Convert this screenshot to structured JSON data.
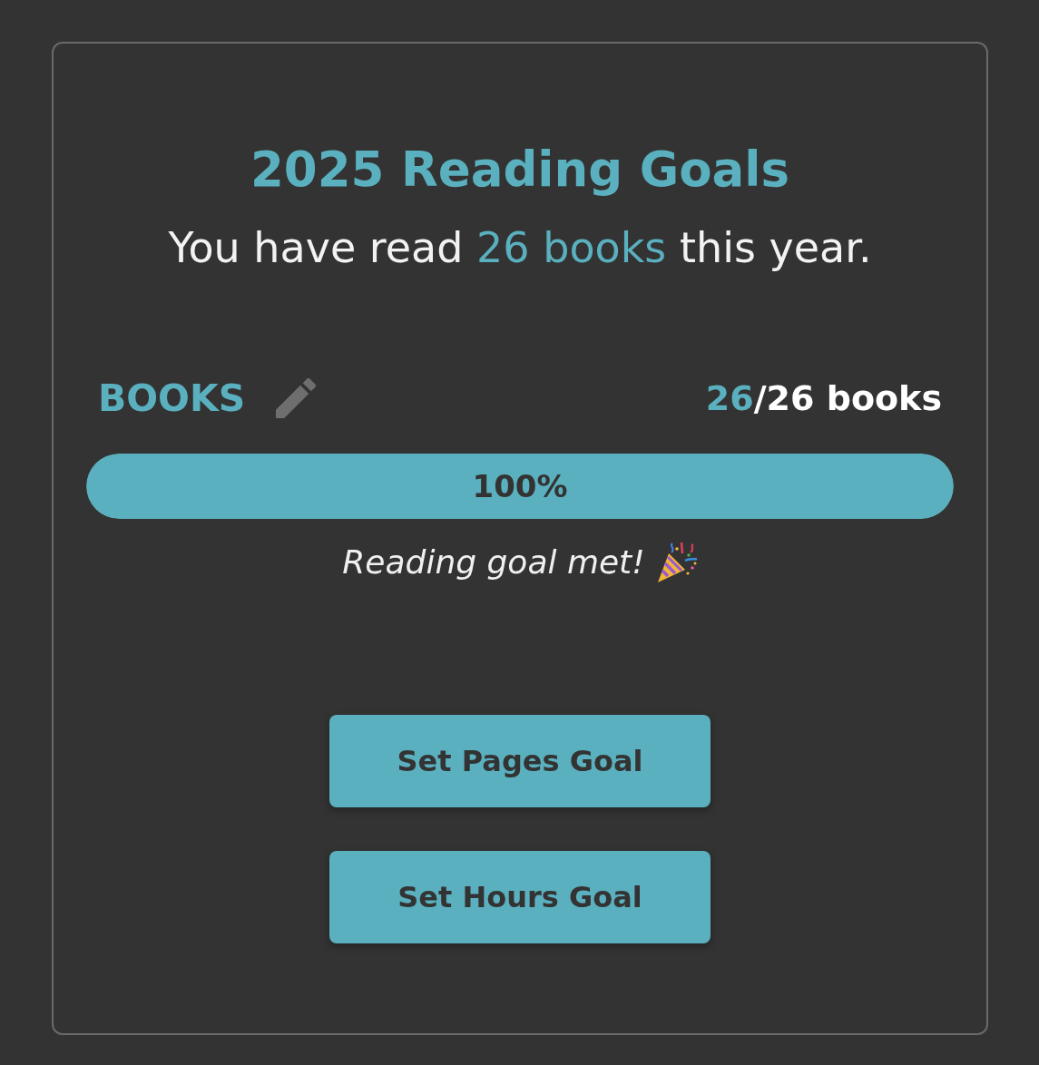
{
  "card": {
    "title": "2025 Reading Goals",
    "summary": "You have read **26 books** this year."
  },
  "goal": {
    "label": "BOOKS",
    "current": "26",
    "total": "/26 books",
    "level": 1,
    "percent": "100%",
    "message": "Reading goal met!"
  },
  "buttons": [
    {
      "label": "Set Pages Goal"
    },
    {
      "label": "Set Hours Goal"
    }
  ]
}
